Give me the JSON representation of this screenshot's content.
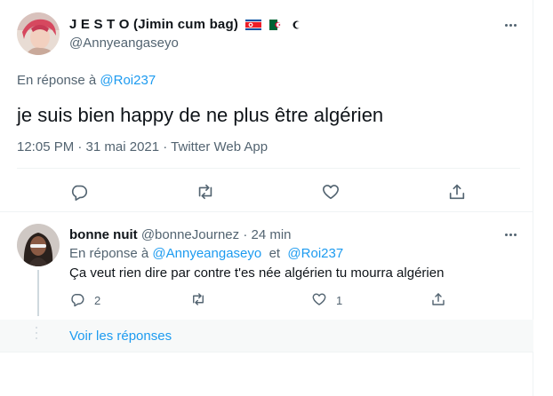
{
  "main_tweet": {
    "display_name": "J E S T O (Jimin cum bag)",
    "flags": [
      "north-korea-flag",
      "algeria-flag"
    ],
    "handle": "@Annyeangaseyo",
    "reply_prefix": "En réponse à",
    "reply_to": "@Roi237",
    "text": "je suis bien happy de ne plus être algérien",
    "meta": "12:05 PM · 31 mai 2021 · Twitter Web App",
    "actions": [
      "reply-icon",
      "retweet-icon",
      "like-icon",
      "share-icon"
    ]
  },
  "reply_tweet": {
    "display_name": "bonne nuit",
    "handle": "@bonneJournez",
    "dot": "·",
    "time": "24 min",
    "reply_prefix": "En réponse à",
    "reply_to_1": "@Annyeangaseyo",
    "reply_and": "et",
    "reply_to_2": "@Roi237",
    "text": "Ça veut rien dire par contre t'es née algérien tu mourra algérien",
    "reply_count": "2",
    "retweet_count": "",
    "like_count": "1"
  },
  "show_replies_label": "Voir les réponses",
  "colors": {
    "accent": "#1d9bf0",
    "muted": "#536471",
    "text": "#0f1419",
    "border": "#eff3f4"
  }
}
